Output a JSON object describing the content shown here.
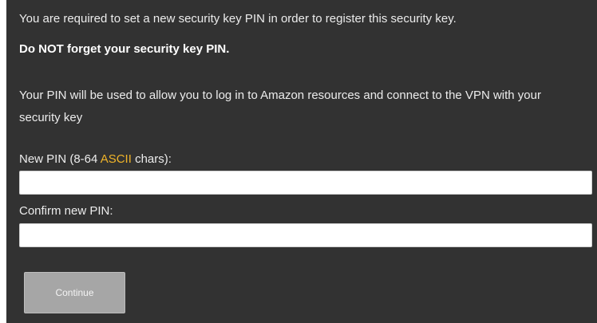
{
  "form": {
    "intro": "You are required to set a new security key PIN in order to register this security key.",
    "warning": "Do NOT forget your security key PIN.",
    "description": "Your PIN will be used to allow you to log in to Amazon resources and connect to the VPN with your security key",
    "new_pin": {
      "label_prefix": "New PIN (8-64 ",
      "label_link": "ASCII",
      "label_suffix": " chars):",
      "value": "",
      "placeholder": ""
    },
    "confirm_pin": {
      "label": "Confirm new PIN:",
      "value": "",
      "placeholder": ""
    },
    "continue_label": "Continue"
  },
  "colors": {
    "background": "#323232",
    "text": "#ececec",
    "link": "#f0b429",
    "button": "#a6a6a6"
  }
}
